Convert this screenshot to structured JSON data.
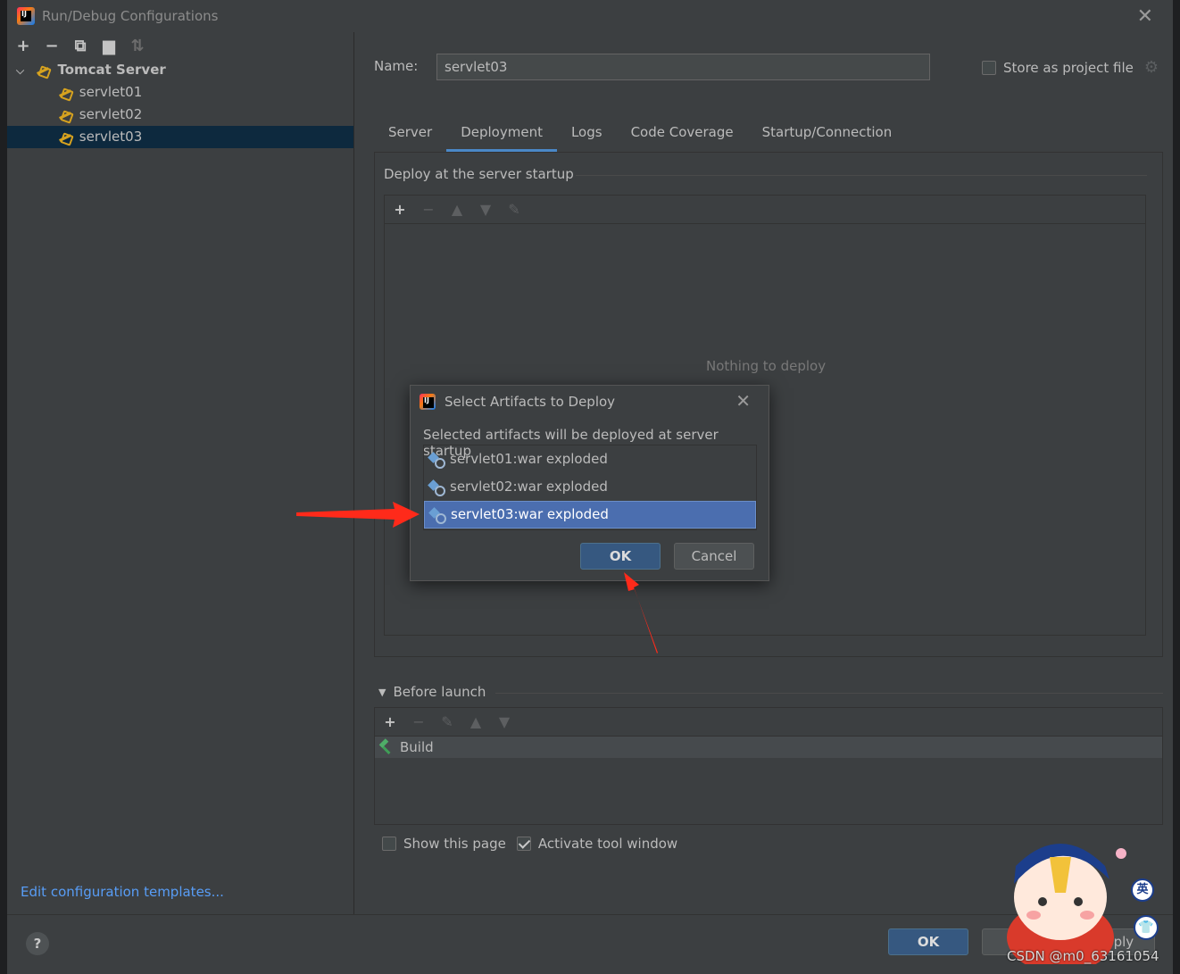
{
  "window": {
    "title": "Run/Debug Configurations",
    "app_icon_text": "IJ"
  },
  "left_panel": {
    "toolbar": [
      {
        "icon": "plus-icon",
        "glyph": "+"
      },
      {
        "icon": "minus-icon",
        "glyph": "−"
      },
      {
        "icon": "copy-icon",
        "glyph": "⧉"
      },
      {
        "icon": "folder-icon",
        "glyph": "▆"
      },
      {
        "icon": "sort-icon",
        "glyph": "⇅"
      }
    ],
    "tree_root": "Tomcat Server",
    "tree_items": [
      "servlet01",
      "servlet02",
      "servlet03"
    ],
    "selected_item": "servlet03",
    "edit_templates_link": "Edit configuration templates..."
  },
  "config": {
    "name_label": "Name:",
    "name_value": "servlet03",
    "store_label": "Store as project file",
    "store_checked": false
  },
  "tabs": [
    {
      "label": "Server",
      "active": false
    },
    {
      "label": "Deployment",
      "active": true
    },
    {
      "label": "Logs",
      "active": false
    },
    {
      "label": "Code Coverage",
      "active": false
    },
    {
      "label": "Startup/Connection",
      "active": false
    }
  ],
  "deployment": {
    "section_label": "Deploy at the server startup",
    "empty_text": "Nothing to deploy"
  },
  "before_launch": {
    "label": "Before launch",
    "items": [
      "Build"
    ]
  },
  "footer_checks": {
    "show_page_label": "Show this page",
    "show_page_checked": false,
    "activate_label": "Activate tool window",
    "activate_checked": true
  },
  "bottom_buttons": {
    "help": "?",
    "ok": "OK",
    "cancel": "",
    "apply": "Apply"
  },
  "dialog": {
    "title": "Select Artifacts to Deploy",
    "description": "Selected artifacts will be deployed at server startup",
    "artifacts": [
      "servlet01:war exploded",
      "servlet02:war exploded",
      "servlet03:war exploded"
    ],
    "selected_artifact": "servlet03:war exploded",
    "ok": "OK",
    "cancel": "Cancel"
  },
  "overlay": {
    "watermark": "CSDN @m0_63161054",
    "lang_badge": "英",
    "annotation_color": "#ff2a1a"
  }
}
